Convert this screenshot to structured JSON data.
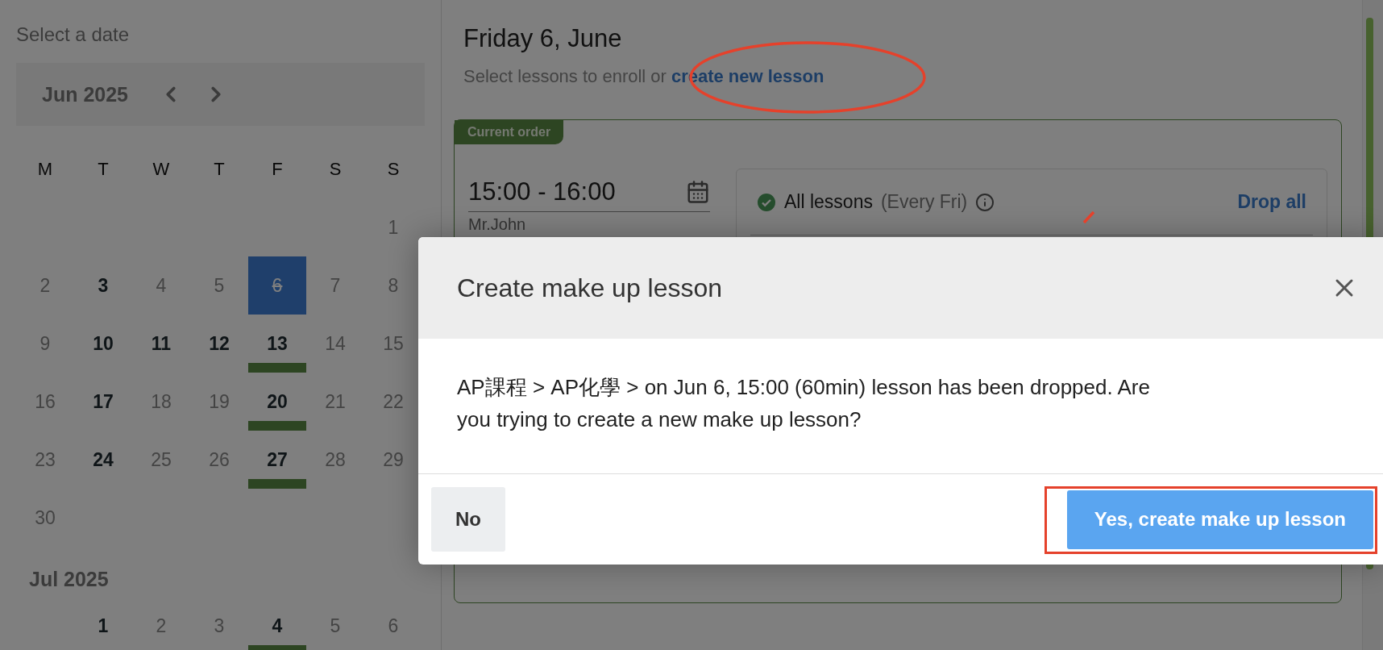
{
  "calendar": {
    "title": "Select a date",
    "current_month": "Jun 2025",
    "weekdays": [
      "M",
      "T",
      "W",
      "T",
      "F",
      "S",
      "S"
    ],
    "months": [
      {
        "weeks": [
          [
            {
              "kind": "blank"
            },
            {
              "kind": "blank"
            },
            {
              "kind": "blank"
            },
            {
              "kind": "blank"
            },
            {
              "kind": "blank"
            },
            {
              "kind": "blank"
            },
            {
              "kind": "day",
              "day": "1",
              "bold": false,
              "selected": false,
              "lesson": false,
              "dropped": false
            }
          ],
          [
            {
              "day": "2",
              "bold": false,
              "selected": false,
              "lesson": false,
              "dropped": false
            },
            {
              "day": "3",
              "bold": true,
              "selected": false,
              "lesson": false,
              "dropped": false
            },
            {
              "day": "4",
              "bold": false,
              "selected": false,
              "lesson": false,
              "dropped": false
            },
            {
              "day": "5",
              "bold": false,
              "selected": false,
              "lesson": false,
              "dropped": false
            },
            {
              "day": "6",
              "bold": false,
              "selected": true,
              "lesson": false,
              "dropped": true
            },
            {
              "day": "7",
              "bold": false,
              "selected": false,
              "lesson": false,
              "dropped": false
            },
            {
              "day": "8",
              "bold": false,
              "selected": false,
              "lesson": false,
              "dropped": false
            }
          ],
          [
            {
              "day": "9",
              "bold": false,
              "selected": false,
              "lesson": false,
              "dropped": false
            },
            {
              "day": "10",
              "bold": true,
              "selected": false,
              "lesson": false,
              "dropped": false
            },
            {
              "day": "11",
              "bold": true,
              "selected": false,
              "lesson": false,
              "dropped": false
            },
            {
              "day": "12",
              "bold": true,
              "selected": false,
              "lesson": false,
              "dropped": false
            },
            {
              "day": "13",
              "bold": true,
              "selected": false,
              "lesson": true,
              "dropped": false
            },
            {
              "day": "14",
              "bold": false,
              "selected": false,
              "lesson": false,
              "dropped": false
            },
            {
              "day": "15",
              "bold": false,
              "selected": false,
              "lesson": false,
              "dropped": false
            }
          ],
          [
            {
              "day": "16",
              "bold": false,
              "selected": false,
              "lesson": false,
              "dropped": false
            },
            {
              "day": "17",
              "bold": true,
              "selected": false,
              "lesson": false,
              "dropped": false
            },
            {
              "day": "18",
              "bold": false,
              "selected": false,
              "lesson": false,
              "dropped": false
            },
            {
              "day": "19",
              "bold": false,
              "selected": false,
              "lesson": false,
              "dropped": false
            },
            {
              "day": "20",
              "bold": true,
              "selected": false,
              "lesson": true,
              "dropped": false
            },
            {
              "day": "21",
              "bold": false,
              "selected": false,
              "lesson": false,
              "dropped": false
            },
            {
              "day": "22",
              "bold": false,
              "selected": false,
              "lesson": false,
              "dropped": false
            }
          ],
          [
            {
              "day": "23",
              "bold": false,
              "selected": false,
              "lesson": false,
              "dropped": false
            },
            {
              "day": "24",
              "bold": true,
              "selected": false,
              "lesson": false,
              "dropped": false
            },
            {
              "day": "25",
              "bold": false,
              "selected": false,
              "lesson": false,
              "dropped": false
            },
            {
              "day": "26",
              "bold": false,
              "selected": false,
              "lesson": false,
              "dropped": false
            },
            {
              "day": "27",
              "bold": true,
              "selected": false,
              "lesson": true,
              "dropped": false
            },
            {
              "day": "28",
              "bold": false,
              "selected": false,
              "lesson": false,
              "dropped": false
            },
            {
              "day": "29",
              "bold": false,
              "selected": false,
              "lesson": false,
              "dropped": false
            }
          ],
          [
            {
              "day": "30",
              "bold": false,
              "selected": false,
              "lesson": false,
              "dropped": false
            }
          ]
        ]
      },
      {
        "label": "Jul 2025",
        "weeks": [
          [
            {
              "kind": "blank"
            },
            {
              "kind": "day",
              "day": "1",
              "bold": true,
              "selected": false,
              "lesson": false,
              "dropped": false
            },
            {
              "day": "2",
              "bold": false,
              "selected": false,
              "lesson": false,
              "dropped": false
            },
            {
              "day": "3",
              "bold": false,
              "selected": false,
              "lesson": false,
              "dropped": false
            },
            {
              "day": "4",
              "bold": true,
              "selected": false,
              "lesson": true,
              "dropped": false
            },
            {
              "day": "5",
              "bold": false,
              "selected": false,
              "lesson": false,
              "dropped": false
            },
            {
              "day": "6",
              "bold": false,
              "selected": false,
              "lesson": false,
              "dropped": false
            }
          ]
        ]
      }
    ]
  },
  "main": {
    "title": "Friday 6, June",
    "subtitle": "Select lessons to enroll or",
    "link": "create new lesson",
    "order": {
      "tag": "Current order",
      "time": "15:00 - 16:00",
      "teacher": "Mr.John",
      "lessons": {
        "label": "All lessons",
        "note": "(Every Fri)",
        "checked": true,
        "action": "Drop all"
      }
    }
  },
  "dialog": {
    "title": "Create make up lesson",
    "message": "AP課程 > AP化學 > on Jun 6, 15:00 (60min) lesson has been dropped. Are you trying to create a new make up lesson?",
    "buttons": [
      {
        "label": "No",
        "kind": "secondary"
      },
      {
        "label": "Yes, create make up lesson",
        "kind": "primary"
      }
    ]
  },
  "annotations": [
    {
      "kind": "ellipse"
    },
    {
      "kind": "frame"
    },
    {
      "kind": "stroke"
    }
  ]
}
